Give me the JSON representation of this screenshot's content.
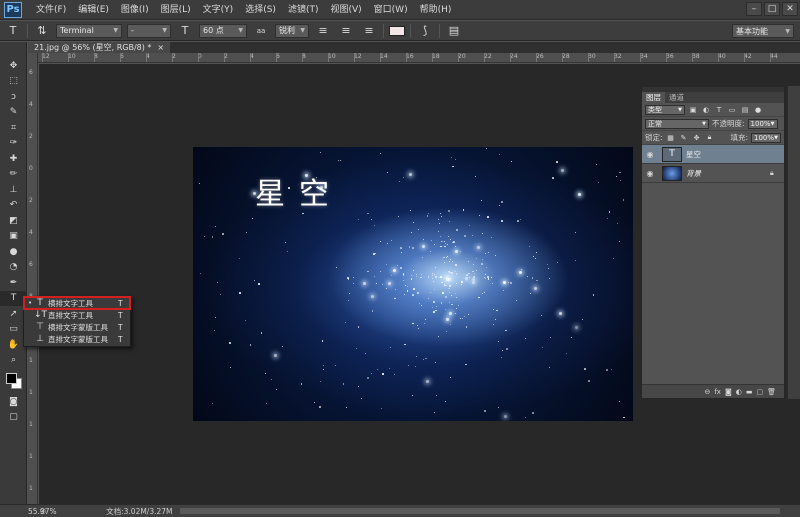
{
  "app": {
    "logo": "Ps"
  },
  "menu": [
    "文件(F)",
    "编辑(E)",
    "图像(I)",
    "图层(L)",
    "文字(Y)",
    "选择(S)",
    "滤镜(T)",
    "视图(V)",
    "窗口(W)",
    "帮助(H)"
  ],
  "window_controls": [
    "–",
    "□",
    "✕"
  ],
  "options": {
    "font_family": "Terminal",
    "font_style": "-",
    "font_size": "60 点",
    "aa_icon": "aa",
    "antialias": "锐利",
    "workspace": "基本功能",
    "text_color": "#f2e6e6"
  },
  "document": {
    "tab": "21.jpg @ 56% (星空, RGB/8) *",
    "close": "×"
  },
  "ruler_top": [
    "12",
    "10",
    "8",
    "6",
    "4",
    "2",
    "0",
    "2",
    "4",
    "6",
    "8",
    "10",
    "12",
    "14",
    "16",
    "18",
    "20",
    "22",
    "24",
    "26",
    "28",
    "30",
    "32",
    "34",
    "36",
    "38",
    "40",
    "42",
    "44"
  ],
  "ruler_left": [
    "6",
    "4",
    "2",
    "0",
    "2",
    "4",
    "6",
    "8",
    "1",
    "1",
    "1",
    "1",
    "1",
    "1"
  ],
  "canvas_text": "星空",
  "flyout": [
    {
      "label": "横排文字工具",
      "key": "T",
      "selected": true
    },
    {
      "label": "直排文字工具",
      "key": "T",
      "selected": false
    },
    {
      "label": "横排文字蒙版工具",
      "key": "T",
      "selected": false
    },
    {
      "label": "直排文字蒙版工具",
      "key": "T",
      "selected": false
    }
  ],
  "layers_panel": {
    "tabs": [
      "图层",
      "通道"
    ],
    "filter_kind": "类型",
    "blend_mode": "正常",
    "opacity_label": "不透明度:",
    "opacity_value": "100%",
    "lock_label": "锁定:",
    "fill_label": "填充:",
    "fill_value": "100%",
    "layers": [
      {
        "name": "星空",
        "type": "text",
        "selected": true
      },
      {
        "name": "背景",
        "type": "image",
        "selected": false
      }
    ]
  },
  "status": {
    "zoom": "55.97%",
    "doc": "文档:3.02M/3.27M"
  },
  "icons": {
    "tools": [
      "move-icon",
      "marquee-icon",
      "lasso-icon",
      "quick-select-icon",
      "crop-icon",
      "eyedropper-icon",
      "healing-brush-icon",
      "brush-icon",
      "clone-stamp-icon",
      "history-brush-icon",
      "eraser-icon",
      "gradient-icon",
      "blur-icon",
      "dodge-icon",
      "pen-icon",
      "type-icon",
      "path-select-icon",
      "rectangle-icon",
      "hand-icon",
      "zoom-icon"
    ]
  }
}
